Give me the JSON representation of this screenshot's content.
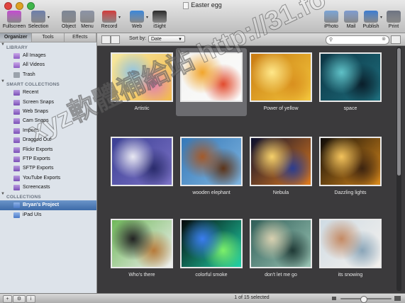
{
  "window": {
    "title": "Easter egg",
    "controls": [
      "close",
      "minimize",
      "zoom"
    ]
  },
  "toolbar": {
    "left": [
      {
        "label": "Fullscreen",
        "icon": "fullscreen-icon",
        "color": "#c24bd0"
      },
      {
        "label": "Selection",
        "icon": "selection-icon",
        "color": "#6d7eaa",
        "menu": true
      },
      {
        "label": "Object",
        "icon": "object-icon",
        "color": "#7c8595"
      },
      {
        "label": "Menu",
        "icon": "menu-icon",
        "color": "#8b93a5"
      },
      {
        "label": "Record",
        "icon": "record-icon",
        "color": "#d23a3a",
        "menu": true
      },
      {
        "label": "Web",
        "icon": "web-icon",
        "color": "#3a86d9",
        "menu": true
      },
      {
        "label": "iSight",
        "icon": "isight-icon",
        "color": "#2b2b2b"
      }
    ],
    "right": [
      {
        "label": "iPhoto",
        "icon": "iphoto-icon",
        "color": "#7aa4d6"
      },
      {
        "label": "Mail",
        "icon": "mail-icon",
        "color": "#7d9bd0"
      },
      {
        "label": "Publish",
        "icon": "publish-icon",
        "color": "#3b7cd1",
        "menu": true
      },
      {
        "label": "Print",
        "icon": "print-icon",
        "color": "#6d7381"
      }
    ]
  },
  "sidebar": {
    "tabs": [
      {
        "label": "Organizer",
        "active": true
      },
      {
        "label": "Tools",
        "active": false
      },
      {
        "label": "Effects",
        "active": false
      }
    ],
    "sections": [
      {
        "heading": "LIBRARY",
        "items": [
          {
            "label": "All Images",
            "icon": "all-images-icon",
            "type": "lib"
          },
          {
            "label": "All Videos",
            "icon": "all-videos-icon",
            "type": "vid"
          },
          {
            "label": "Trash",
            "icon": "trash-icon",
            "type": "trash"
          }
        ]
      },
      {
        "heading": "SMART COLLECTIONS",
        "items": [
          {
            "label": "Recent",
            "icon": "smart-collection-icon",
            "type": "smart"
          },
          {
            "label": "Screen Snaps",
            "icon": "smart-collection-icon",
            "type": "smart"
          },
          {
            "label": "Web Snaps",
            "icon": "smart-collection-icon",
            "type": "smart"
          },
          {
            "label": "Cam Snaps",
            "icon": "smart-collection-icon",
            "type": "smart"
          },
          {
            "label": "Imports",
            "icon": "smart-collection-icon",
            "type": "smart"
          },
          {
            "label": "Dragged Out",
            "icon": "smart-collection-icon",
            "type": "smart"
          },
          {
            "label": "Flickr Exports",
            "icon": "smart-collection-icon",
            "type": "smart"
          },
          {
            "label": "FTP Exports",
            "icon": "smart-collection-icon",
            "type": "smart"
          },
          {
            "label": "SFTP Exports",
            "icon": "smart-collection-icon",
            "type": "smart"
          },
          {
            "label": "YouTube Exports",
            "icon": "smart-collection-icon",
            "type": "smart"
          },
          {
            "label": "Screencasts",
            "icon": "smart-collection-icon",
            "type": "smart"
          }
        ]
      },
      {
        "heading": "COLLECTIONS",
        "items": [
          {
            "label": "Bryan's Project",
            "icon": "collection-icon",
            "type": "coll",
            "selected": true
          },
          {
            "label": "iPad UIs",
            "icon": "collection-icon",
            "type": "coll"
          }
        ]
      }
    ]
  },
  "content": {
    "sort_label": "Sort by:",
    "sort_value": "Date",
    "search_placeholder": "",
    "status": "1 of 15 selected",
    "zoom_level": 0.45,
    "thumbnails": [
      {
        "caption": "Artistic",
        "colors": [
          "#f7e9a0",
          "#f2b94c",
          "#8fc5e8",
          "#e07fb0"
        ],
        "selected": false
      },
      {
        "caption": "",
        "colors": [
          "#f4f4f2",
          "#fbfbfb",
          "#f2a52b",
          "#e24b2d"
        ],
        "selected": true
      },
      {
        "caption": "Power of yellow",
        "colors": [
          "#c97a12",
          "#f3c73d",
          "#ffe88a",
          "#d9901f"
        ],
        "selected": false
      },
      {
        "caption": "space",
        "colors": [
          "#0c3443",
          "#1e6f7e",
          "#5fc1c7",
          "#0a1e2a"
        ],
        "selected": false
      },
      {
        "caption": "",
        "colors": [
          "#3a3f93",
          "#7d73c7",
          "#e8e8f2",
          "#2a2c6c"
        ],
        "selected": false
      },
      {
        "caption": "wooden elephant",
        "colors": [
          "#3578b8",
          "#7fb5e0",
          "#a45a2a",
          "#5d3418"
        ],
        "selected": false
      },
      {
        "caption": "Nebula",
        "colors": [
          "#0b0f2e",
          "#e07b1d",
          "#f6d16b",
          "#2c3d8f"
        ],
        "selected": false
      },
      {
        "caption": "Dazzling lights",
        "colors": [
          "#0f0b08",
          "#d98a1c",
          "#f3c35c",
          "#3d2410"
        ],
        "selected": false
      },
      {
        "caption": "Who's there",
        "colors": [
          "#6fb85a",
          "#f0f0f0",
          "#222222",
          "#b67a3a"
        ],
        "selected": false
      },
      {
        "caption": "colorful smoke",
        "colors": [
          "#05080a",
          "#1fd3a8",
          "#3a7df0",
          "#7df06a"
        ],
        "selected": false
      },
      {
        "caption": "don't let me go",
        "colors": [
          "#2f5d57",
          "#9ac4b4",
          "#d8d0b0",
          "#203a36"
        ],
        "selected": false
      },
      {
        "caption": "its snowing",
        "colors": [
          "#cfdbe3",
          "#f4f1ee",
          "#c48a64",
          "#8aa5b8"
        ],
        "selected": false
      }
    ]
  },
  "watermark": "xyz軟體補給站 http://31.fo"
}
